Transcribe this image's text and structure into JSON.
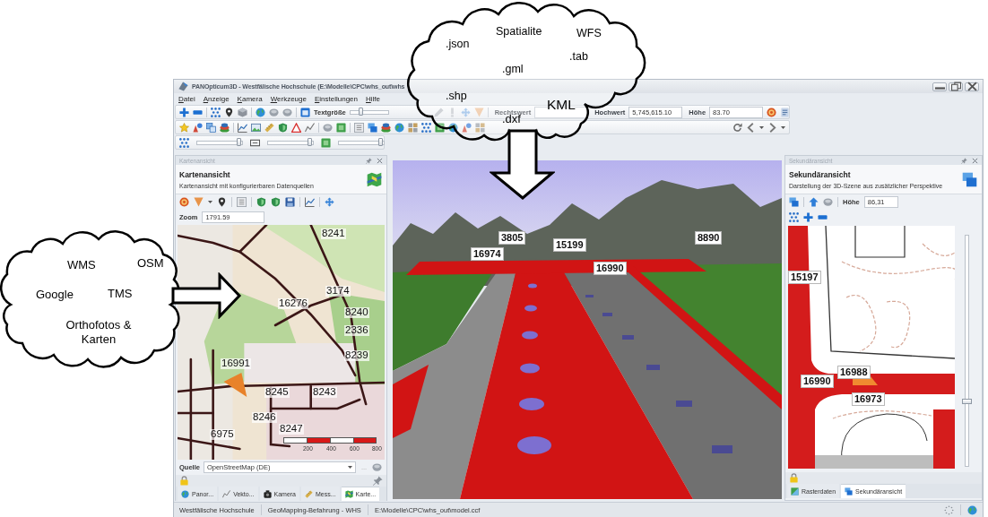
{
  "top_cloud": {
    "labels": [
      ".json",
      "Spatialite",
      "WFS",
      ".tab",
      ".gml",
      ".shp",
      "KML",
      ".dxf"
    ]
  },
  "left_cloud": {
    "labels": [
      "WMS",
      "OSM",
      "Google",
      "TMS",
      "Orthofotos & Karten"
    ]
  },
  "window": {
    "title": "PANOpticum3D - Westfälische Hochschule (E:\\Modelle\\CPC\\whs_out\\whs"
  },
  "menu": [
    "Datei",
    "Anzeige",
    "Kamera",
    "Werkzeuge",
    "Einstellungen",
    "Hilfe"
  ],
  "toolbar": {
    "text_size": {
      "label": "Textgröße",
      "level": 0.3
    },
    "coordinates": [
      {
        "label": "Rechtswert"
      },
      {
        "label": "Hochwert",
        "value": "5,745,615.10"
      },
      {
        "label": "Höhe",
        "value": "83.70"
      }
    ]
  },
  "toolbar_3": {
    "sliders": [
      {
        "level": 0.94
      },
      {
        "level": 0.94
      },
      {
        "level": 0.93
      }
    ]
  },
  "left_panel": {
    "pane_title": "Kartenansicht",
    "title": "Kartenansicht",
    "subtitle": "Kartenansicht mit konfigurierbaren Datenquellen",
    "zoom": {
      "label": "Zoom",
      "value": "1791.59"
    },
    "map_labels": [
      "8241",
      "16276",
      "3174",
      "8240",
      "2336",
      "8239",
      "16991",
      "8245",
      "8243",
      "8246",
      "8247",
      "6975"
    ],
    "scale_labels": [
      "200",
      "400",
      "600",
      "800"
    ],
    "source": {
      "label": "Quelle",
      "value": "OpenStreetMap (DE)"
    },
    "more_button": "...",
    "tabs": [
      {
        "label": "Panor...",
        "selected": false
      },
      {
        "label": "Vekto...",
        "selected": false
      },
      {
        "label": "Kamera",
        "selected": false
      },
      {
        "label": "Mess...",
        "selected": false
      },
      {
        "label": "Karte...",
        "selected": true
      }
    ]
  },
  "view_3d": {
    "labels": [
      "16974",
      "3805",
      "15199",
      "16990",
      "8890"
    ]
  },
  "right_panel": {
    "pane_title": "Sekundäransicht",
    "title": "Sekundäransicht",
    "subtitle": "Darstellung der 3D-Szene aus zusätzlicher Perspektive",
    "height": {
      "label": "Höhe",
      "value": "86,31"
    },
    "map_labels": [
      "15197",
      "16988",
      "16990",
      "16973"
    ],
    "slider": {
      "level": 0.28
    },
    "tabs": [
      {
        "label": "Rasterdaten",
        "selected": false
      },
      {
        "label": "Sekundäransicht",
        "selected": true
      }
    ]
  },
  "status_bar": [
    "Westfälische Hochschule",
    "GeoMapping-Befahrung - WHS",
    "E:\\Modelle\\CPC\\whs_out\\model.ccf"
  ]
}
